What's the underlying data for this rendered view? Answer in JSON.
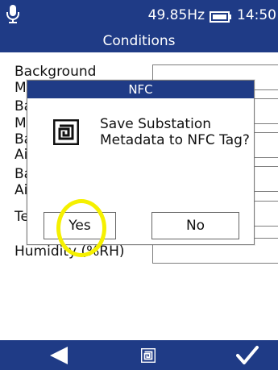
{
  "status": {
    "frequency": "49.85Hz",
    "time": "14:50"
  },
  "header": {
    "title": "Conditions"
  },
  "form": {
    "labels": [
      "Background",
      "M",
      "Ba",
      "M",
      "Ba",
      "Ai",
      "Ba",
      "Ai",
      "Te",
      "Humidity (%RH)"
    ]
  },
  "dialog": {
    "title": "NFC",
    "message": "Save Substation Metadata to NFC Tag?",
    "yes_label": "Yes",
    "no_label": "No"
  },
  "colors": {
    "primary": "#1f3b86",
    "highlight": "#f5f000"
  },
  "icons": {
    "top_left": "microphone-icon",
    "battery": "battery-icon",
    "dialog": "nfc-tag-icon",
    "nav_back": "back-arrow-icon",
    "nav_center": "nfc-tag-icon",
    "nav_confirm": "checkmark-icon"
  }
}
